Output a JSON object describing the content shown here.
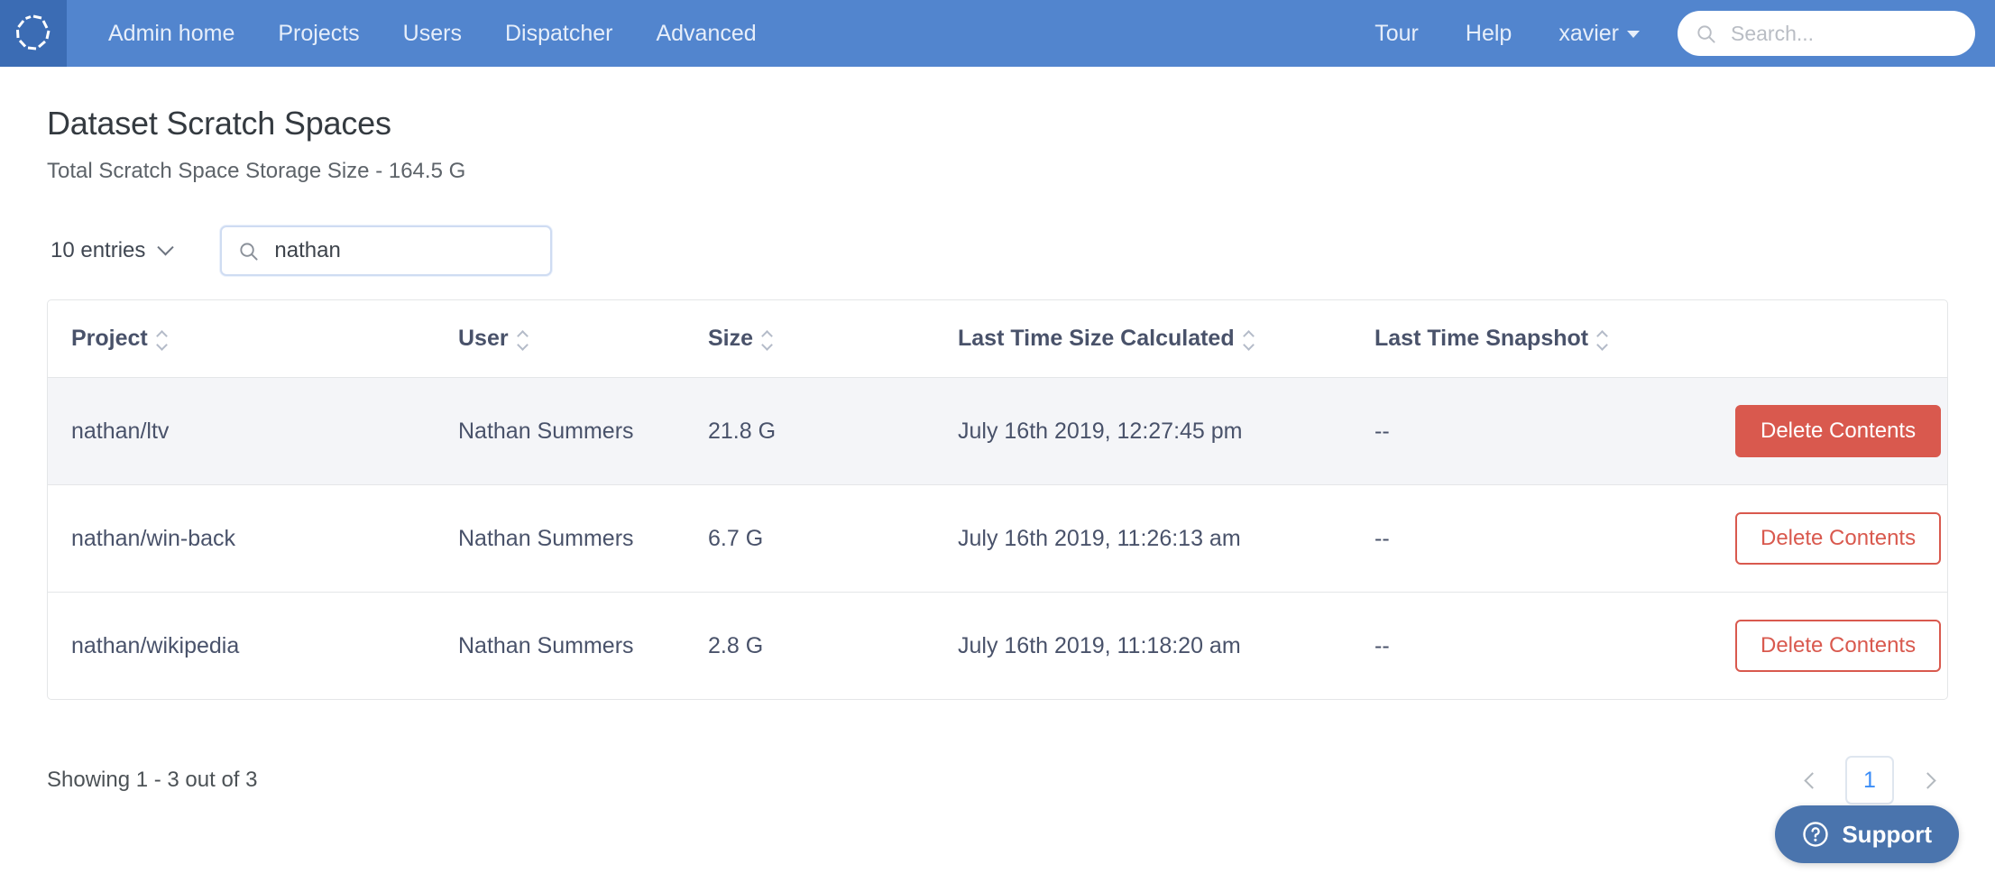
{
  "navbar": {
    "logo_icon": "aperture-spinner-logo-icon",
    "brand_color": "#5285ce",
    "logo_box_color": "#3b6cb4",
    "links": [
      {
        "label": "Admin home"
      },
      {
        "label": "Projects"
      },
      {
        "label": "Users"
      },
      {
        "label": "Dispatcher"
      },
      {
        "label": "Advanced"
      }
    ],
    "right_links": [
      {
        "label": "Tour"
      },
      {
        "label": "Help"
      }
    ],
    "user_menu": {
      "label": "xavier",
      "caret_icon": "caret-down-icon"
    },
    "search": {
      "value": "",
      "placeholder": "Search...",
      "icon": "search-icon"
    }
  },
  "page": {
    "title": "Dataset Scratch Spaces",
    "subtitle": "Total Scratch Space Storage Size - 164.5 G"
  },
  "controls": {
    "entries": {
      "label": "10 entries",
      "chevron_icon": "chevron-down-icon"
    },
    "search": {
      "value": "nathan",
      "placeholder": "Search",
      "icon": "search-icon"
    }
  },
  "table": {
    "columns": [
      {
        "label": "Project",
        "sort_icon": "sort-updown-icon"
      },
      {
        "label": "User",
        "sort_icon": "sort-updown-icon"
      },
      {
        "label": "Size",
        "sort_icon": "sort-updown-icon"
      },
      {
        "label": "Last Time Size Calculated",
        "sort_icon": "sort-updown-icon"
      },
      {
        "label": "Last Time Snapshot",
        "sort_icon": "sort-updown-icon"
      }
    ],
    "rows": [
      {
        "project": "nathan/ltv",
        "user": "Nathan Summers",
        "size": "21.8 G",
        "last_time_size_calculated": "July 16th 2019, 12:27:45 pm",
        "last_time_snapshot": "--",
        "action_label": "Delete Contents",
        "action_style": "solid"
      },
      {
        "project": "nathan/win-back",
        "user": "Nathan Summers",
        "size": "6.7 G",
        "last_time_size_calculated": "July 16th 2019, 11:26:13 am",
        "last_time_snapshot": "--",
        "action_label": "Delete Contents",
        "action_style": "outline"
      },
      {
        "project": "nathan/wikipedia",
        "user": "Nathan Summers",
        "size": "2.8 G",
        "last_time_size_calculated": "July 16th 2019, 11:18:20 am",
        "last_time_snapshot": "--",
        "action_label": "Delete Contents",
        "action_style": "outline"
      }
    ]
  },
  "footer": {
    "showing": "Showing 1 - 3 out of 3",
    "pagination": {
      "prev_icon": "chevron-left-icon",
      "next_icon": "chevron-right-icon",
      "current_page": "1"
    }
  },
  "support": {
    "label": "Support",
    "icon": "question-circle-icon",
    "color": "#4a74ad"
  },
  "colors": {
    "danger": "#d9594e",
    "accent": "#3b8df7",
    "row_highlight": "#f4f5f8"
  }
}
